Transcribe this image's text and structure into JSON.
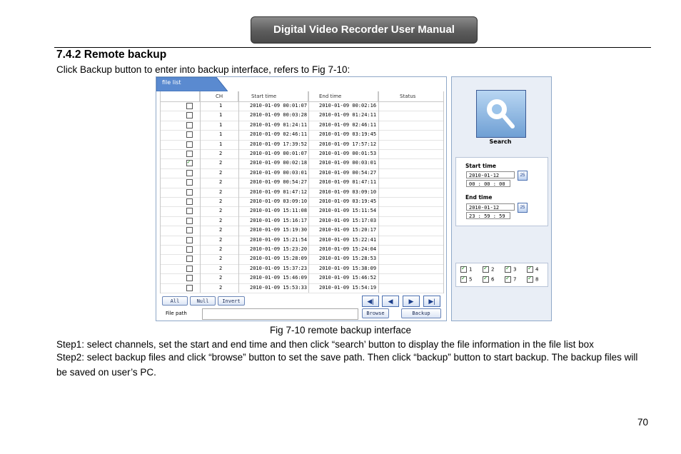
{
  "header": {
    "title": "Digital Video Recorder User Manual"
  },
  "section": {
    "title": "7.4.2  Remote backup",
    "intro": "Click Backup button to enter into backup interface, refers to Fig 7-10:",
    "caption": "Fig 7-10 remote backup interface",
    "step1": "Step1: select channels, set the start and end time and then click “search’ button to display the file information in the file list box",
    "step2": "Step2: select backup files and click “browse” button to set the save path. Then click “backup” button to start backup. The backup files will be saved on user’s PC.",
    "page_number": "70"
  },
  "figure": {
    "tab_label": "file list",
    "columns": [
      "CH",
      "Start time",
      "End time",
      "Status"
    ],
    "rows": [
      {
        "checked": false,
        "ch": "1",
        "start": "2010-01-09 00:01:07",
        "end": "2010-01-09 00:02:16"
      },
      {
        "checked": false,
        "ch": "1",
        "start": "2010-01-09 00:03:28",
        "end": "2010-01-09 01:24:11"
      },
      {
        "checked": false,
        "ch": "1",
        "start": "2010-01-09 01:24:11",
        "end": "2010-01-09 02:46:11"
      },
      {
        "checked": false,
        "ch": "1",
        "start": "2010-01-09 02:46:11",
        "end": "2010-01-09 03:19:45"
      },
      {
        "checked": false,
        "ch": "1",
        "start": "2010-01-09 17:39:52",
        "end": "2010-01-09 17:57:12"
      },
      {
        "checked": false,
        "ch": "2",
        "start": "2010-01-09 00:01:07",
        "end": "2010-01-09 00:01:53"
      },
      {
        "checked": true,
        "ch": "2",
        "start": "2010-01-09 00:02:18",
        "end": "2010-01-09 00:03:01"
      },
      {
        "checked": false,
        "ch": "2",
        "start": "2010-01-09 00:03:01",
        "end": "2010-01-09 00:54:27"
      },
      {
        "checked": false,
        "ch": "2",
        "start": "2010-01-09 00:54:27",
        "end": "2010-01-09 01:47:11"
      },
      {
        "checked": false,
        "ch": "2",
        "start": "2010-01-09 01:47:12",
        "end": "2010-01-09 03:09:10"
      },
      {
        "checked": false,
        "ch": "2",
        "start": "2010-01-09 03:09:10",
        "end": "2010-01-09 03:19:45"
      },
      {
        "checked": false,
        "ch": "2",
        "start": "2010-01-09 15:11:08",
        "end": "2010-01-09 15:11:54"
      },
      {
        "checked": false,
        "ch": "2",
        "start": "2010-01-09 15:16:17",
        "end": "2010-01-09 15:17:03"
      },
      {
        "checked": false,
        "ch": "2",
        "start": "2010-01-09 15:19:30",
        "end": "2010-01-09 15:20:17"
      },
      {
        "checked": false,
        "ch": "2",
        "start": "2010-01-09 15:21:54",
        "end": "2010-01-09 15:22:41"
      },
      {
        "checked": false,
        "ch": "2",
        "start": "2010-01-09 15:23:20",
        "end": "2010-01-09 15:24:04"
      },
      {
        "checked": false,
        "ch": "2",
        "start": "2010-01-09 15:28:09",
        "end": "2010-01-09 15:28:53"
      },
      {
        "checked": false,
        "ch": "2",
        "start": "2010-01-09 15:37:23",
        "end": "2010-01-09 15:38:09"
      },
      {
        "checked": false,
        "ch": "2",
        "start": "2010-01-09 15:46:09",
        "end": "2010-01-09 15:46:52"
      },
      {
        "checked": false,
        "ch": "2",
        "start": "2010-01-09 15:53:33",
        "end": "2010-01-09 15:54:19"
      }
    ],
    "buttons": {
      "all": "All",
      "null": "Null",
      "invert": "Invert",
      "browse": "Browse",
      "backup": "Backup"
    },
    "nav_icons": [
      "first-page-icon",
      "prev-page-icon",
      "next-page-icon",
      "last-page-icon"
    ],
    "file_path_label": "File path",
    "file_path_value": "",
    "search_label": "Search",
    "start_time_label": "Start time",
    "start_date": "2010-01-12",
    "start_time": "00 : 00 : 00",
    "end_time_label": "End time",
    "end_date": "2010-01-12",
    "end_time": "23 : 59 : 59",
    "calendar_label": "25",
    "channels": [
      "1",
      "2",
      "3",
      "4",
      "5",
      "6",
      "7",
      "8"
    ]
  }
}
